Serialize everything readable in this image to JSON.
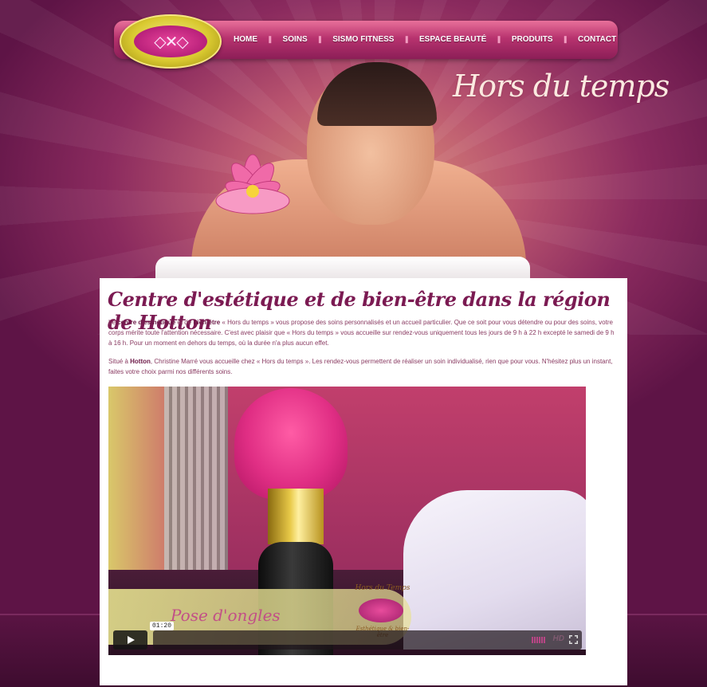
{
  "nav": {
    "items": [
      {
        "label": "HOME"
      },
      {
        "label": "SOINS"
      },
      {
        "label": "SISMO FITNESS"
      },
      {
        "label": "ESPACE BEAUTÉ"
      },
      {
        "label": "PRODUITS"
      },
      {
        "label": "CONTACT"
      }
    ]
  },
  "hero": {
    "title": "Hors du temps"
  },
  "content": {
    "title": "Centre d'estétique et de bien-être dans la région de Hotton",
    "para1": {
      "t1": "Le ",
      "b1": "centre d'esthétique",
      "t2": " et de ",
      "b2": "bien-être",
      "t3": " « Hors du temps » vous propose des soins personnalisés et un accueil particulier. Que ce soit pour vous détendre ou pour des soins, votre corps mérite toute l'attention nécessaire. C'est avec plaisir que « Hors du temps » vous accueille sur rendez-vous uniquement tous les jours de 9 h à 22 h excepté le samedi de 9 h à 16 h. Pour un moment en dehors du temps, où la durée n'a plus aucun effet."
    },
    "para2": {
      "t1": "Situé à ",
      "b1": "Hotton",
      "t2": ", Christine Marré vous accueille chez « Hors du temps ». Les rendez-vous permettent de réaliser un soin individualisé, rien que pour vous. N'hésitez plus un instant, faites votre choix parmi nos différents soins."
    }
  },
  "video": {
    "caption": "Pose d'ongles",
    "brand": "Hors du Temps",
    "brand_sub": "Esthétique & bien-être",
    "time": "01:20",
    "hd": "HD",
    "icons": {
      "play": "play-icon",
      "volume": "volume-icon",
      "fullscreen": "fullscreen-icon"
    }
  }
}
